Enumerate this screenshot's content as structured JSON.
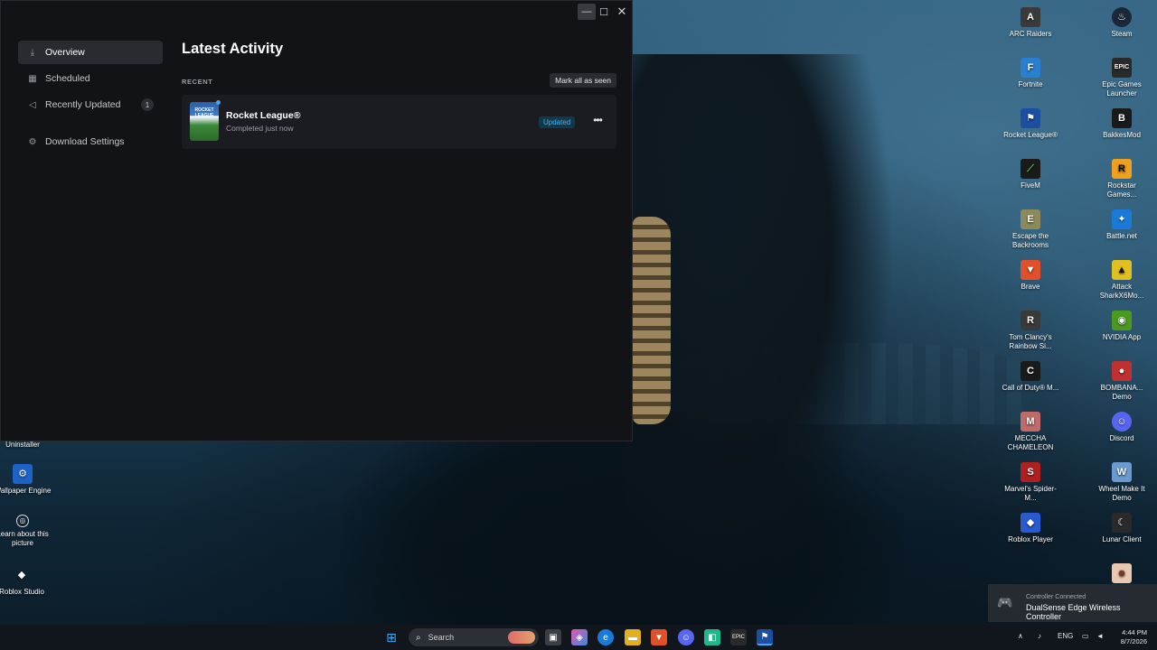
{
  "app": {
    "sidebar": {
      "items": [
        {
          "label": "Overview",
          "icon": "download-icon",
          "active": true
        },
        {
          "label": "Scheduled",
          "icon": "calendar-icon"
        },
        {
          "label": "Recently Updated",
          "icon": "megaphone-icon",
          "badge": "1"
        },
        {
          "label": "Download Settings",
          "icon": "gear-icon"
        }
      ]
    },
    "main": {
      "title": "Latest Activity",
      "section_label": "RECENT",
      "mark_all_label": "Mark all as seen",
      "activity": {
        "game_title": "Rocket League®",
        "subtitle": "Completed just now",
        "status": "Updated",
        "thumb_text": "ROCKET LEAGUE"
      }
    }
  },
  "desktop": {
    "left_icons": [
      {
        "label": "Uninstaller"
      },
      {
        "label": "Wallpaper Engine",
        "color": "#1e62c8"
      },
      {
        "label": "Learn about this picture",
        "color": "#2d2f33"
      },
      {
        "label": "Roblox Studio",
        "color": "#2d2f33"
      }
    ],
    "right_col1": [
      {
        "label": "ARC Raiders",
        "color": "#3a3a3a"
      },
      {
        "label": "Fortnite",
        "color": "#2a7fd0"
      },
      {
        "label": "Rocket League®",
        "color": "#1c4fa0"
      },
      {
        "label": "FiveM",
        "color": "#1a1a1a"
      },
      {
        "label": "Escape the Backrooms",
        "color": "#8a8a5a"
      },
      {
        "label": "Brave",
        "color": "#e0502a"
      },
      {
        "label": "Tom Clancy's Rainbow Si...",
        "color": "#3a3a3a"
      },
      {
        "label": "Call of Duty® M...",
        "color": "#1a1a1a"
      },
      {
        "label": "MECCHA CHAMELEON",
        "color": "#c06a6a"
      },
      {
        "label": "Marvel's Spider-M...",
        "color": "#b02020"
      },
      {
        "label": "Roblox Player",
        "color": "#2a5ad0"
      }
    ],
    "right_col2": [
      {
        "label": "Steam",
        "color": "#1b2838"
      },
      {
        "label": "Epic Games Launcher",
        "color": "#2a2a2a"
      },
      {
        "label": "BakkesMod",
        "color": "#1a1a1a"
      },
      {
        "label": "Rockstar Games...",
        "color": "#f0a020"
      },
      {
        "label": "Battle.net",
        "color": "#1a7ad8"
      },
      {
        "label": "Attack SharkX6Mo...",
        "color": "#e0c020"
      },
      {
        "label": "NVIDIA App",
        "color": "#4a9a20"
      },
      {
        "label": "BOMBANA... Demo",
        "color": "#c03030"
      },
      {
        "label": "Discord",
        "color": "#5865f2"
      },
      {
        "label": "Wheel Make It Demo",
        "color": "#6a9ad0"
      },
      {
        "label": "Lunar Client",
        "color": "#2a2a2a"
      },
      {
        "label": "",
        "color": "#e8c8b0"
      }
    ]
  },
  "notification": {
    "heading": "Controller Connected",
    "message": "DualSense Edge Wireless Controller"
  },
  "taskbar": {
    "search_label": "Search",
    "language": "ENG",
    "time": "4:44 PM",
    "date": "8/7/2026"
  }
}
